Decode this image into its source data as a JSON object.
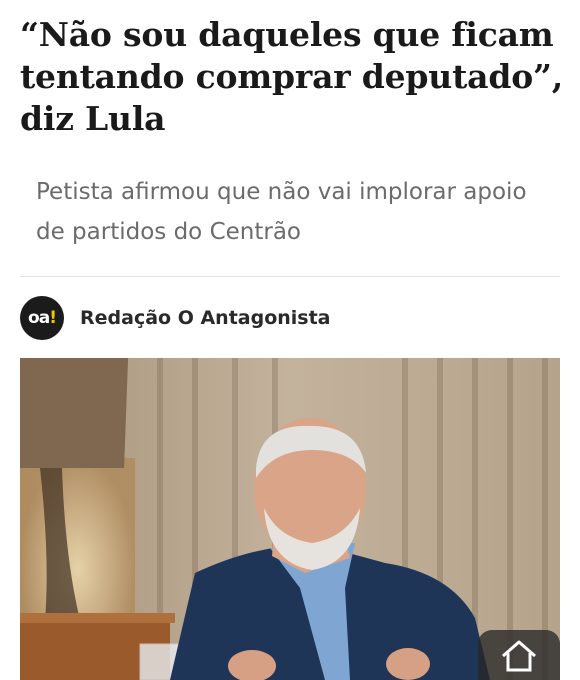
{
  "article": {
    "headline": "“Não sou daqueles que ficam tentando comprar deputado”, diz Lula",
    "subtitle": "Petista afirmou que não vai implorar apoio de partidos do Centrão"
  },
  "byline": {
    "logo_text": "oa",
    "logo_accent": "!",
    "author": "Redação O Antagonista"
  },
  "icons": {
    "home": "home-icon"
  },
  "colors": {
    "headline": "#1a1a1a",
    "subtitle": "#6b6b6b",
    "logo_bg": "#1b1b1b",
    "logo_accent": "#f5c400"
  }
}
